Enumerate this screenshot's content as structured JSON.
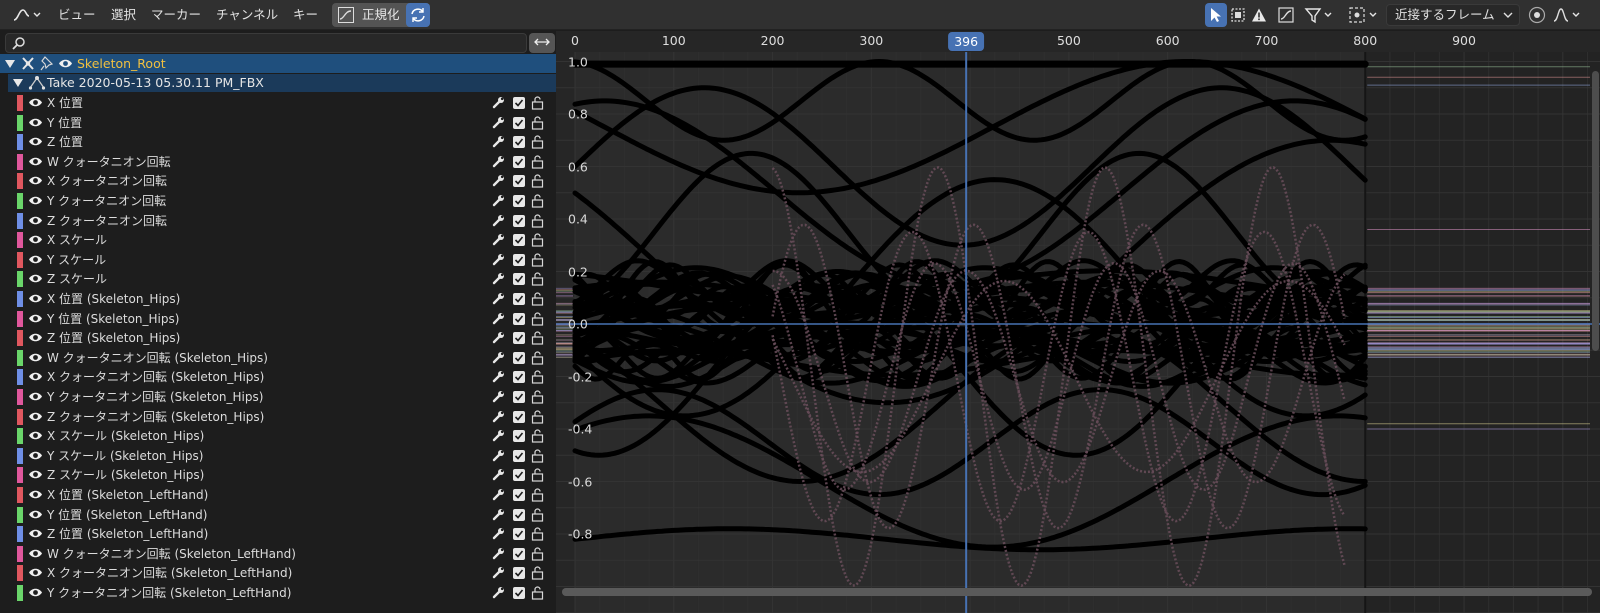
{
  "header": {
    "editor_type_icon": "graph-editor-icon",
    "menus": [
      "ビュー",
      "選択",
      "マーカー",
      "チャンネル",
      "キー"
    ],
    "normalize_label": "正規化",
    "pivot_label": "近接するフレーム",
    "colors": {
      "active": "#4772b3",
      "header_bg": "#303030"
    }
  },
  "search": {
    "placeholder": "",
    "value": ""
  },
  "channels": {
    "root_label": "Skeleton_Root",
    "take_label": "Take 2020-05-13 05.30.11 PM_FBX",
    "items": [
      {
        "label": "X 位置",
        "color": "#e0575f"
      },
      {
        "label": "Y 位置",
        "color": "#6ad56a"
      },
      {
        "label": "Z 位置",
        "color": "#6f8fe6"
      },
      {
        "label": "W クォータニオン回転",
        "color": "#e0579c"
      },
      {
        "label": "X クォータニオン回転",
        "color": "#e0575f"
      },
      {
        "label": "Y クォータニオン回転",
        "color": "#6ad56a"
      },
      {
        "label": "Z クォータニオン回転",
        "color": "#6f8fe6"
      },
      {
        "label": "X スケール",
        "color": "#e0579c"
      },
      {
        "label": "Y スケール",
        "color": "#e0575f"
      },
      {
        "label": "Z スケール",
        "color": "#6ad56a"
      },
      {
        "label": "X 位置 (Skeleton_Hips)",
        "color": "#6f8fe6"
      },
      {
        "label": "Y 位置 (Skeleton_Hips)",
        "color": "#e0579c"
      },
      {
        "label": "Z 位置 (Skeleton_Hips)",
        "color": "#e0575f"
      },
      {
        "label": "W クォータニオン回転 (Skeleton_Hips)",
        "color": "#6ad56a"
      },
      {
        "label": "X クォータニオン回転 (Skeleton_Hips)",
        "color": "#6f8fe6"
      },
      {
        "label": "Y クォータニオン回転 (Skeleton_Hips)",
        "color": "#e0579c"
      },
      {
        "label": "Z クォータニオン回転 (Skeleton_Hips)",
        "color": "#e0575f"
      },
      {
        "label": "X スケール (Skeleton_Hips)",
        "color": "#6ad56a"
      },
      {
        "label": "Y スケール (Skeleton_Hips)",
        "color": "#6f8fe6"
      },
      {
        "label": "Z スケール (Skeleton_Hips)",
        "color": "#e0579c"
      },
      {
        "label": "X 位置 (Skeleton_LeftHand)",
        "color": "#e0575f"
      },
      {
        "label": "Y 位置 (Skeleton_LeftHand)",
        "color": "#6ad56a"
      },
      {
        "label": "Z 位置 (Skeleton_LeftHand)",
        "color": "#6f8fe6"
      },
      {
        "label": "W クォータニオン回転 (Skeleton_LeftHand)",
        "color": "#e0579c"
      },
      {
        "label": "X クォータニオン回転 (Skeleton_LeftHand)",
        "color": "#e0575f"
      },
      {
        "label": "Y クォータニオン回転 (Skeleton_LeftHand)",
        "color": "#6ad56a"
      }
    ]
  },
  "graph": {
    "current_frame": "396",
    "frame_ticks": [
      "0",
      "100",
      "200",
      "300",
      "400",
      "500",
      "600",
      "700",
      "800",
      "900"
    ],
    "value_ticks": [
      "1.0",
      "0.8",
      "0.6",
      "0.4",
      "0.2",
      "0.0",
      "-0.2",
      "-0.4",
      "-0.6",
      "-0.8"
    ],
    "frame_end": 800,
    "colors": {
      "cursor": "#4772b3",
      "curve": "#000000"
    }
  }
}
